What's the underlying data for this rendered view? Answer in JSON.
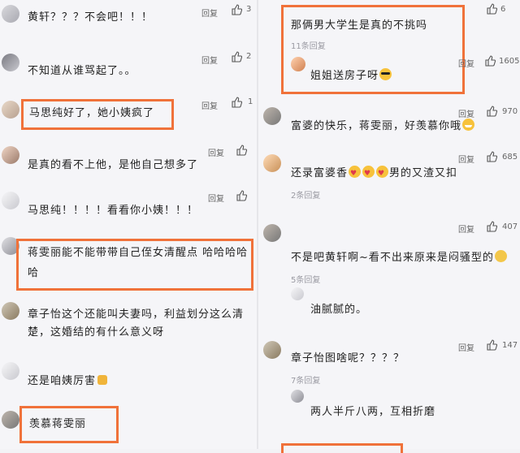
{
  "left": {
    "comments": [
      {
        "text": "黄轩？？？不会吧！！！",
        "reply": "回复",
        "likes": "3"
      },
      {
        "text": "不知道从谁骂起了。。",
        "reply": "回复",
        "likes": "2"
      },
      {
        "text": "马思纯好了，她小姨疯了",
        "reply": "回复",
        "likes": "1"
      },
      {
        "text": "是真的看不上他，是他自己想多了",
        "reply": "回复",
        "likes": ""
      },
      {
        "text": "马思纯！！！！看看你小姨！！！",
        "reply": "回复",
        "likes": ""
      },
      {
        "text_line1": "蒋雯丽能不能带带自己侄女清醒点 哈哈哈哈",
        "text_line2": "哈",
        "reply": "回复",
        "likes": ""
      },
      {
        "text_line1": "章子怡这个还能叫夫妻吗，利益划分这么清",
        "text_line2": "楚，这婚结的有什么意义呀",
        "reply": "回复",
        "likes": ""
      },
      {
        "text": "还是咱姨厉害",
        "reply": "回复",
        "likes": ""
      },
      {
        "text": "羡慕蒋雯丽",
        "reply": "回复",
        "likes": ""
      }
    ]
  },
  "right": {
    "comments": [
      {
        "text": "那俩男大学生是真的不挑吗",
        "sub": "11条回复",
        "reply_text": "姐姐送房子呀",
        "reply": "回复",
        "likes": "1605"
      },
      {
        "text": "富婆的快乐，蒋雯丽，好羡慕你哦",
        "reply": "回复",
        "likes": "970"
      },
      {
        "text": "还录富婆香",
        "text_tail": "男的又渣又扣",
        "sub": "2条回复",
        "reply": "回复",
        "likes": "685"
      },
      {
        "text": "不是吧黄轩啊~看不出来原来是闷骚型的",
        "sub": "5条回复",
        "reply_text": "油腻腻的。",
        "reply": "回复",
        "likes": "407"
      },
      {
        "text": "章子怡图啥呢？？？？",
        "sub": "7条回复",
        "reply_text": "两人半斤八两，互相折磨",
        "reply": "回复",
        "likes": "147"
      }
    ],
    "top_likes": "6"
  },
  "colors": {
    "highlight": "#f0723a",
    "text": "#222222",
    "muted": "#9a9aa2"
  },
  "icons": [
    "thumb-up-icon",
    "avatar",
    "emoji-sunglasses",
    "emoji-heart-eyes",
    "emoji-grin",
    "emoji-thumbs-up"
  ]
}
